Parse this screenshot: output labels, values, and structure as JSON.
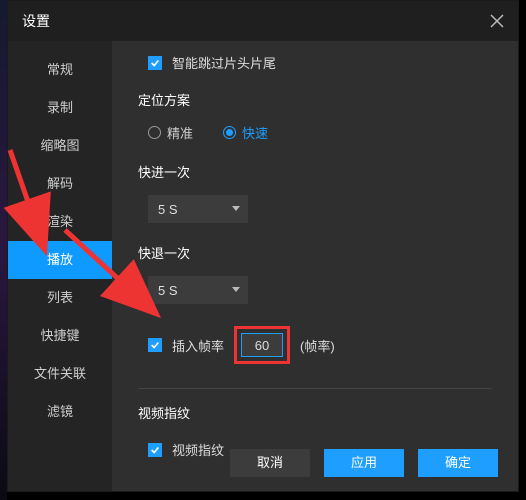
{
  "titlebar": {
    "title": "设置"
  },
  "sidebar": {
    "items": [
      {
        "label": "常规"
      },
      {
        "label": "录制"
      },
      {
        "label": "缩略图"
      },
      {
        "label": "解码"
      },
      {
        "label": "渲染"
      },
      {
        "label": "播放",
        "active": true
      },
      {
        "label": "列表"
      },
      {
        "label": "快捷键"
      },
      {
        "label": "文件关联"
      },
      {
        "label": "滤镜"
      }
    ]
  },
  "content": {
    "skip_intro_outro": {
      "label": "智能跳过片头片尾",
      "checked": true
    },
    "positioning": {
      "title": "定位方案",
      "options": [
        {
          "label": "精准",
          "selected": false
        },
        {
          "label": "快速",
          "selected": true
        }
      ]
    },
    "fast_forward": {
      "title": "快进一次",
      "value": "5 S"
    },
    "fast_backward": {
      "title": "快退一次",
      "value": "5 S"
    },
    "insert_fps": {
      "label": "插入帧率",
      "value": "60",
      "unit": "(帧率)",
      "checked": true
    },
    "video_fingerprint": {
      "title": "视频指纹",
      "label": "视频指纹",
      "checked": true
    }
  },
  "footer": {
    "cancel": "取消",
    "apply": "应用",
    "ok": "确定"
  }
}
